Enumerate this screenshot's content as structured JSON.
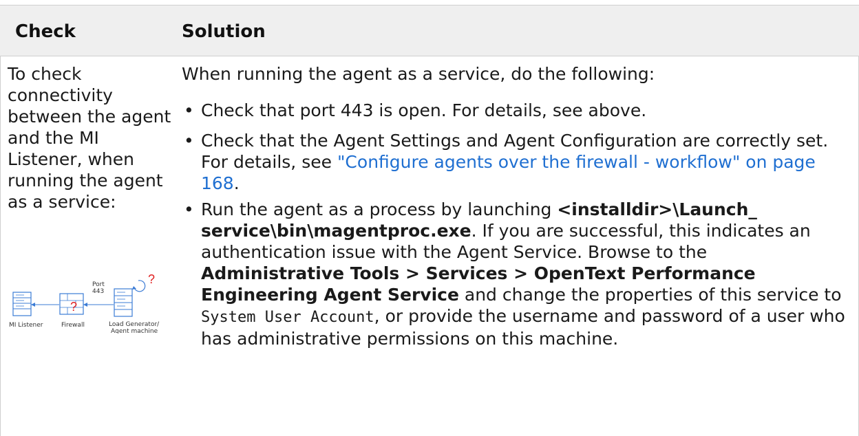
{
  "table": {
    "headers": {
      "check": "Check",
      "solution": "Solution"
    },
    "row": {
      "check_text": "To check connectivity between the agent and the MI Listener, when running the agent as a service:",
      "diagram": {
        "labels": {
          "listener": "MI Listener",
          "firewall": "Firewall",
          "port": "Port",
          "port_number": "443",
          "loadgen": "Load Generator/",
          "machine": "Agent machine",
          "question": "?"
        }
      },
      "solution": {
        "intro": "When running the agent as a service, do the following:",
        "bullets": [
          {
            "bullet": "•",
            "text": "Check that port 443 is open. For details, see above."
          },
          {
            "bullet": "•",
            "text_before": "Check that the Agent Settings and Agent Configuration are correctly set. For details, see ",
            "link": "\"Configure agents over the firewall - workflow\" on page 168",
            "text_after": "."
          },
          {
            "bullet": "•",
            "p1": "Run the agent as a process by launching ",
            "b1": "<installdir>\\Launch_ service\\bin\\magentproc.exe",
            "p2": ". If you are successful, this indicates an authentication issue with the Agent Service. Browse to the ",
            "b2": "Administrative Tools > Services >  OpenText Performance Engineering Agent Service",
            "p3": " and change the properties of this service to ",
            "code": "System User Account",
            "p4": ", or provide the username and password of a user who has administrative permissions on this machine."
          }
        ]
      }
    }
  }
}
